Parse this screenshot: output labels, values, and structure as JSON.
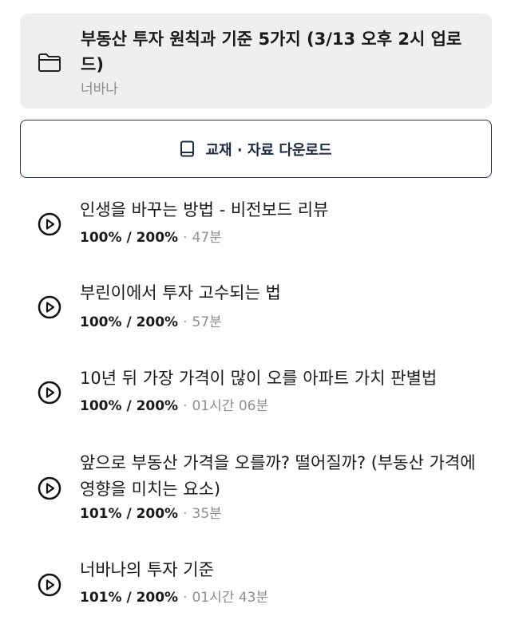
{
  "folder": {
    "icon": "folder-icon",
    "title": "부동산 투자 원칙과 기준 5가지 (3/13 오후 2시 업로드)",
    "author": "너바나"
  },
  "download": {
    "icon": "book-icon",
    "label": "교재 · 자료 다운로드"
  },
  "lessons": [
    {
      "title": "인생을 바꾸는 방법 - 비전보드 리뷰",
      "progress": "100% / 200%",
      "separator": "·",
      "duration": "47분"
    },
    {
      "title": "부린이에서 투자 고수되는 법",
      "progress": "100% / 200%",
      "separator": "·",
      "duration": "57분"
    },
    {
      "title": "10년 뒤 가장 가격이 많이 오를 아파트 가치 판별법",
      "progress": "100% / 200%",
      "separator": "·",
      "duration": "01시간 06분"
    },
    {
      "title": "앞으로 부동산 가격을 오를까? 떨어질까? (부동산 가격에 영향을 미치는 요소)",
      "progress": "101% / 200%",
      "separator": "·",
      "duration": "35분"
    },
    {
      "title": "너바나의 투자 기준",
      "progress": "101% / 200%",
      "separator": "·",
      "duration": "01시간 43분"
    }
  ],
  "colors": {
    "card_bg": "#efefef",
    "button_border": "#2b3550",
    "text_primary": "#1a1a1a",
    "text_secondary": "#8e8e8e"
  }
}
